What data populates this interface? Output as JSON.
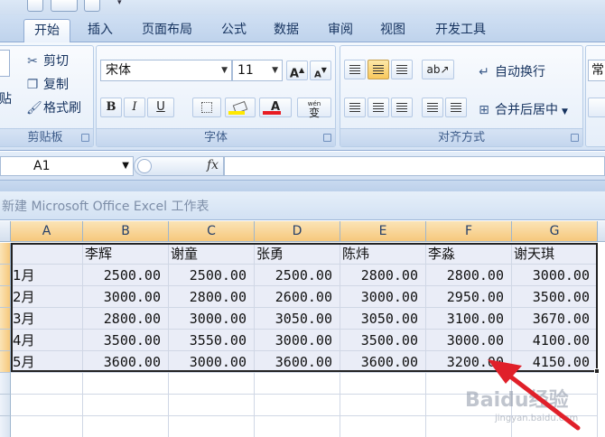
{
  "tabs": [
    "开始",
    "插入",
    "页面布局",
    "公式",
    "数据",
    "审阅",
    "视图",
    "开发工具"
  ],
  "clipboard": {
    "paste_label": "贴",
    "cut_label": "剪切",
    "copy_label": "复制",
    "format_painter_label": "格式刷",
    "group_title": "剪贴板"
  },
  "font": {
    "font_name": "宋体",
    "font_size": "11",
    "bold": "B",
    "italic": "I",
    "underline": "U",
    "font_color_glyph": "A",
    "phonetic_glyph": "wén",
    "phonetic_char": "变",
    "grow_glyph": "A",
    "shrink_glyph": "A",
    "group_title": "字体",
    "font_color_hex": "#e81c23",
    "fill_color_hex": "#ffe800"
  },
  "alignment": {
    "wrap_text_label": "自动换行",
    "merge_center_label": "合并后居中",
    "group_title": "对齐方式"
  },
  "number": {
    "format_partial": "常"
  },
  "formula_bar": {
    "name_box": "A1",
    "fx_label": "fx",
    "formula": ""
  },
  "workbook_title": "新建 Microsoft Office Excel 工作表",
  "columns": [
    "A",
    "B",
    "C",
    "D",
    "E",
    "F",
    "G"
  ],
  "sheet": {
    "header": [
      "",
      "李辉",
      "谢童",
      "张勇",
      "陈炜",
      "李淼",
      "谢天琪"
    ],
    "rows": [
      [
        "1月",
        "2500.00",
        "2500.00",
        "2500.00",
        "2800.00",
        "2800.00",
        "3000.00"
      ],
      [
        "2月",
        "3000.00",
        "2800.00",
        "2600.00",
        "3000.00",
        "2950.00",
        "3500.00"
      ],
      [
        "3月",
        "2800.00",
        "3000.00",
        "3050.00",
        "3050.00",
        "3100.00",
        "3670.00"
      ],
      [
        "4月",
        "3500.00",
        "3550.00",
        "3000.00",
        "3500.00",
        "3000.00",
        "4100.00"
      ],
      [
        "5月",
        "3600.00",
        "3000.00",
        "3600.00",
        "3600.00",
        "3200.00",
        "4150.00"
      ]
    ]
  },
  "watermark": {
    "brand": "Baidu经验",
    "sub": "jingyan.baidu.com"
  },
  "colors": {
    "arrow": "#e0202a",
    "selected_header": "#f6c87c",
    "ribbon": "#dbe7f6"
  }
}
